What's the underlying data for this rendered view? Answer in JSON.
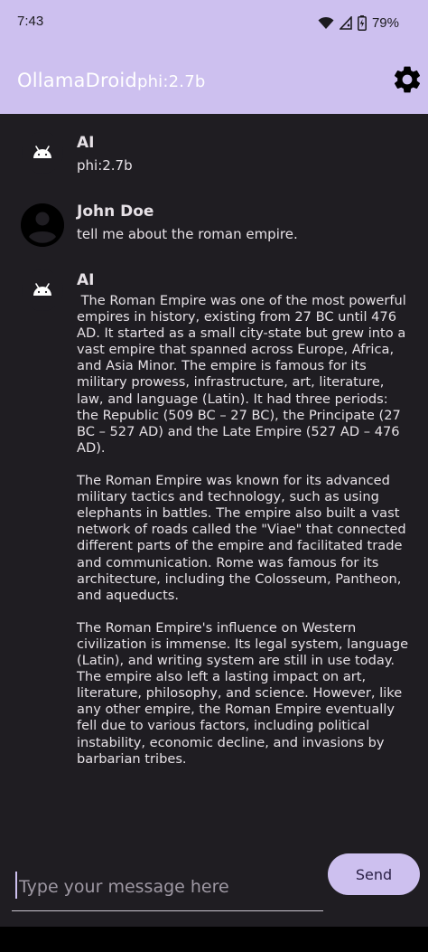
{
  "status": {
    "time": "7:43",
    "battery": "79%"
  },
  "appbar": {
    "title": "OllamaDroid",
    "model": "phi:2.7b"
  },
  "messages": [
    {
      "sender": "AI",
      "text": "phi:2.7b"
    },
    {
      "sender": "John Doe",
      "text": "tell me about the roman empire."
    },
    {
      "sender": "AI",
      "text": " The Roman Empire was one of the most powerful empires in history, existing from 27 BC until 476 AD. It started as a small city-state but grew into a vast empire that spanned across Europe, Africa, and Asia Minor. The empire is famous for its military prowess, infrastructure, art, literature, law, and language (Latin). It had three periods: the Republic (509 BC – 27 BC), the Principate (27 BC – 527 AD) and the Late Empire (527 AD – 476 AD).\n\nThe Roman Empire was known for its advanced military tactics and technology, such as using elephants in battles. The empire also built a vast network of roads called the \"Viae\" that connected different parts of the empire and facilitated trade and communication. Rome was famous for its architecture, including the Colosseum, Pantheon, and aqueducts.\n\nThe Roman Empire's influence on Western civilization is immense. Its legal system, language (Latin), and writing system are still in use today. The empire also left a lasting impact on art, literature, philosophy, and science. However, like any other empire, the Roman Empire eventually fell due to various factors, including political instability, economic decline, and invasions by barbarian tribes."
    }
  ],
  "input": {
    "placeholder": "Type your message here",
    "value": ""
  },
  "send_label": "Send",
  "icons": {
    "status": [
      "wifi-icon",
      "signal-icon",
      "battery-icon"
    ],
    "appbar": "gear-icon",
    "ai_avatar": "android-icon",
    "user_avatar": "person-icon"
  },
  "colors": {
    "appbar": "#cdc0ef",
    "background": "#1f1d22",
    "send_button": "#cdc0ef",
    "text": "#e6e1e6"
  }
}
